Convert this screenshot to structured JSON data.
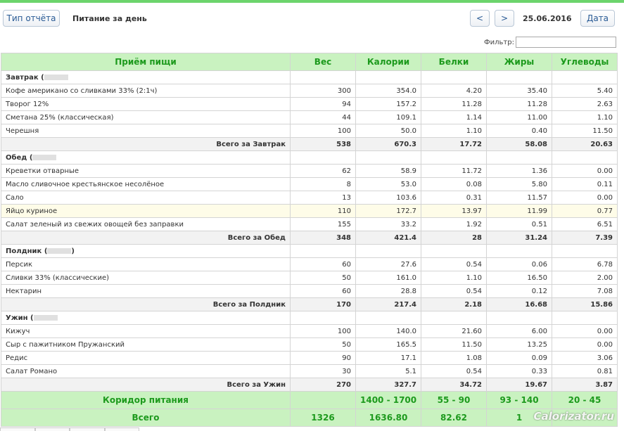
{
  "toolbar": {
    "report_type_label": "Тип отчёта",
    "report_title": "Питание за день",
    "prev_label": "<",
    "next_label": ">",
    "date_text": "25.06.2016",
    "date_button_label": "Дата"
  },
  "filter": {
    "label": "Фильтр:",
    "value": ""
  },
  "table": {
    "columns": [
      "Приём пищи",
      "Вес",
      "Калории",
      "Белки",
      "Жиры",
      "Углеводы"
    ],
    "meals": [
      {
        "title": "Завтрак (",
        "title_suffix": "",
        "items": [
          {
            "name": "Кофе американо со сливками 33% (2:1ч)",
            "weight": "300",
            "kcal": "354.0",
            "protein": "4.20",
            "fat": "35.40",
            "carbs": "5.40"
          },
          {
            "name": "Творог 12%",
            "weight": "94",
            "kcal": "157.2",
            "protein": "11.28",
            "fat": "11.28",
            "carbs": "2.63"
          },
          {
            "name": "Сметана 25% (классическая)",
            "weight": "44",
            "kcal": "109.1",
            "protein": "1.14",
            "fat": "11.00",
            "carbs": "1.10"
          },
          {
            "name": "Черешня",
            "weight": "100",
            "kcal": "50.0",
            "protein": "1.10",
            "fat": "0.40",
            "carbs": "11.50"
          }
        ],
        "total": {
          "label": "Всего за Завтрак",
          "weight": "538",
          "kcal": "670.3",
          "protein": "17.72",
          "fat": "58.08",
          "carbs": "20.63"
        }
      },
      {
        "title": "Обед (",
        "title_suffix": "",
        "items": [
          {
            "name": "Креветки отварные",
            "weight": "62",
            "kcal": "58.9",
            "protein": "11.72",
            "fat": "1.36",
            "carbs": "0.00"
          },
          {
            "name": "Масло сливочное крестьянское несолёное",
            "weight": "8",
            "kcal": "53.0",
            "protein": "0.08",
            "fat": "5.80",
            "carbs": "0.11"
          },
          {
            "name": "Сало",
            "weight": "13",
            "kcal": "103.6",
            "protein": "0.31",
            "fat": "11.57",
            "carbs": "0.00"
          },
          {
            "name": "Яйцо куриное",
            "weight": "110",
            "kcal": "172.7",
            "protein": "13.97",
            "fat": "11.99",
            "carbs": "0.77",
            "highlight": true
          },
          {
            "name": "Салат зеленый из свежих овощей без заправки",
            "weight": "155",
            "kcal": "33.2",
            "protein": "1.92",
            "fat": "0.51",
            "carbs": "6.51"
          }
        ],
        "total": {
          "label": "Всего за Обед",
          "weight": "348",
          "kcal": "421.4",
          "protein": "28",
          "fat": "31.24",
          "carbs": "7.39"
        }
      },
      {
        "title": "Полдник (",
        "title_suffix": ")",
        "items": [
          {
            "name": "Персик",
            "weight": "60",
            "kcal": "27.6",
            "protein": "0.54",
            "fat": "0.06",
            "carbs": "6.78"
          },
          {
            "name": "Сливки 33% (классические)",
            "weight": "50",
            "kcal": "161.0",
            "protein": "1.10",
            "fat": "16.50",
            "carbs": "2.00"
          },
          {
            "name": "Нектарин",
            "weight": "60",
            "kcal": "28.8",
            "protein": "0.54",
            "fat": "0.12",
            "carbs": "7.08"
          }
        ],
        "total": {
          "label": "Всего за Полдник",
          "weight": "170",
          "kcal": "217.4",
          "protein": "2.18",
          "fat": "16.68",
          "carbs": "15.86"
        }
      },
      {
        "title": "Ужин (",
        "title_suffix": "",
        "items": [
          {
            "name": "Кижуч",
            "weight": "100",
            "kcal": "140.0",
            "protein": "21.60",
            "fat": "6.00",
            "carbs": "0.00"
          },
          {
            "name": "Сыр с пажитником Пружанский",
            "weight": "50",
            "kcal": "165.5",
            "protein": "11.50",
            "fat": "13.25",
            "carbs": "0.00"
          },
          {
            "name": "Редис",
            "weight": "90",
            "kcal": "17.1",
            "protein": "1.08",
            "fat": "0.09",
            "carbs": "3.06"
          },
          {
            "name": "Салат Романо",
            "weight": "30",
            "kcal": "5.1",
            "protein": "0.54",
            "fat": "0.33",
            "carbs": "0.81"
          }
        ],
        "total": {
          "label": "Всего за Ужин",
          "weight": "270",
          "kcal": "327.7",
          "protein": "34.72",
          "fat": "19.67",
          "carbs": "3.87"
        }
      }
    ],
    "corridor": {
      "label": "Коридор питания",
      "weight": "",
      "kcal": "1400 - 1700",
      "protein": "55 - 90",
      "fat": "93 - 140",
      "carbs": "20 - 45"
    },
    "grand_total": {
      "label": "Всего",
      "weight": "1326",
      "kcal": "1636.80",
      "protein": "82.62",
      "fat": "1",
      "carbs": ""
    }
  },
  "watermark": "Calorizator.ru",
  "colors": {
    "header_bg": "#c9f2c0",
    "header_text": "#1d9a1d",
    "top_accent": "#6cd46c"
  }
}
